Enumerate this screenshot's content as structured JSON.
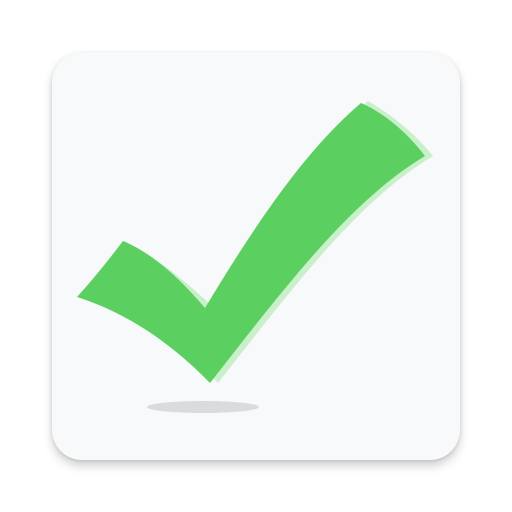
{
  "app_icon": {
    "name": "checkmark-app-icon",
    "colors": {
      "tile_background": "#f8f9fa",
      "check_fill": "#5bcf5f",
      "check_highlight": "#c9efcb",
      "ground_shadow": "#d9dcde"
    }
  }
}
